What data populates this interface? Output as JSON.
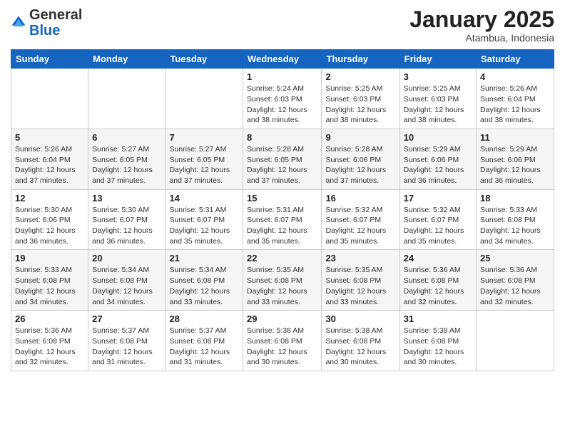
{
  "logo": {
    "general": "General",
    "blue": "Blue"
  },
  "header": {
    "month": "January 2025",
    "location": "Atambua, Indonesia"
  },
  "days_of_week": [
    "Sunday",
    "Monday",
    "Tuesday",
    "Wednesday",
    "Thursday",
    "Friday",
    "Saturday"
  ],
  "weeks": [
    [
      {
        "day": "",
        "info": ""
      },
      {
        "day": "",
        "info": ""
      },
      {
        "day": "",
        "info": ""
      },
      {
        "day": "1",
        "info": "Sunrise: 5:24 AM\nSunset: 6:03 PM\nDaylight: 12 hours and 38 minutes."
      },
      {
        "day": "2",
        "info": "Sunrise: 5:25 AM\nSunset: 6:03 PM\nDaylight: 12 hours and 38 minutes."
      },
      {
        "day": "3",
        "info": "Sunrise: 5:25 AM\nSunset: 6:03 PM\nDaylight: 12 hours and 38 minutes."
      },
      {
        "day": "4",
        "info": "Sunrise: 5:26 AM\nSunset: 6:04 PM\nDaylight: 12 hours and 38 minutes."
      }
    ],
    [
      {
        "day": "5",
        "info": "Sunrise: 5:26 AM\nSunset: 6:04 PM\nDaylight: 12 hours and 37 minutes."
      },
      {
        "day": "6",
        "info": "Sunrise: 5:27 AM\nSunset: 6:05 PM\nDaylight: 12 hours and 37 minutes."
      },
      {
        "day": "7",
        "info": "Sunrise: 5:27 AM\nSunset: 6:05 PM\nDaylight: 12 hours and 37 minutes."
      },
      {
        "day": "8",
        "info": "Sunrise: 5:28 AM\nSunset: 6:05 PM\nDaylight: 12 hours and 37 minutes."
      },
      {
        "day": "9",
        "info": "Sunrise: 5:28 AM\nSunset: 6:06 PM\nDaylight: 12 hours and 37 minutes."
      },
      {
        "day": "10",
        "info": "Sunrise: 5:29 AM\nSunset: 6:06 PM\nDaylight: 12 hours and 36 minutes."
      },
      {
        "day": "11",
        "info": "Sunrise: 5:29 AM\nSunset: 6:06 PM\nDaylight: 12 hours and 36 minutes."
      }
    ],
    [
      {
        "day": "12",
        "info": "Sunrise: 5:30 AM\nSunset: 6:06 PM\nDaylight: 12 hours and 36 minutes."
      },
      {
        "day": "13",
        "info": "Sunrise: 5:30 AM\nSunset: 6:07 PM\nDaylight: 12 hours and 36 minutes."
      },
      {
        "day": "14",
        "info": "Sunrise: 5:31 AM\nSunset: 6:07 PM\nDaylight: 12 hours and 35 minutes."
      },
      {
        "day": "15",
        "info": "Sunrise: 5:31 AM\nSunset: 6:07 PM\nDaylight: 12 hours and 35 minutes."
      },
      {
        "day": "16",
        "info": "Sunrise: 5:32 AM\nSunset: 6:07 PM\nDaylight: 12 hours and 35 minutes."
      },
      {
        "day": "17",
        "info": "Sunrise: 5:32 AM\nSunset: 6:07 PM\nDaylight: 12 hours and 35 minutes."
      },
      {
        "day": "18",
        "info": "Sunrise: 5:33 AM\nSunset: 6:08 PM\nDaylight: 12 hours and 34 minutes."
      }
    ],
    [
      {
        "day": "19",
        "info": "Sunrise: 5:33 AM\nSunset: 6:08 PM\nDaylight: 12 hours and 34 minutes."
      },
      {
        "day": "20",
        "info": "Sunrise: 5:34 AM\nSunset: 6:08 PM\nDaylight: 12 hours and 34 minutes."
      },
      {
        "day": "21",
        "info": "Sunrise: 5:34 AM\nSunset: 6:08 PM\nDaylight: 12 hours and 33 minutes."
      },
      {
        "day": "22",
        "info": "Sunrise: 5:35 AM\nSunset: 6:08 PM\nDaylight: 12 hours and 33 minutes."
      },
      {
        "day": "23",
        "info": "Sunrise: 5:35 AM\nSunset: 6:08 PM\nDaylight: 12 hours and 33 minutes."
      },
      {
        "day": "24",
        "info": "Sunrise: 5:36 AM\nSunset: 6:08 PM\nDaylight: 12 hours and 32 minutes."
      },
      {
        "day": "25",
        "info": "Sunrise: 5:36 AM\nSunset: 6:08 PM\nDaylight: 12 hours and 32 minutes."
      }
    ],
    [
      {
        "day": "26",
        "info": "Sunrise: 5:36 AM\nSunset: 6:08 PM\nDaylight: 12 hours and 32 minutes."
      },
      {
        "day": "27",
        "info": "Sunrise: 5:37 AM\nSunset: 6:08 PM\nDaylight: 12 hours and 31 minutes."
      },
      {
        "day": "28",
        "info": "Sunrise: 5:37 AM\nSunset: 6:08 PM\nDaylight: 12 hours and 31 minutes."
      },
      {
        "day": "29",
        "info": "Sunrise: 5:38 AM\nSunset: 6:08 PM\nDaylight: 12 hours and 30 minutes."
      },
      {
        "day": "30",
        "info": "Sunrise: 5:38 AM\nSunset: 6:08 PM\nDaylight: 12 hours and 30 minutes."
      },
      {
        "day": "31",
        "info": "Sunrise: 5:38 AM\nSunset: 6:08 PM\nDaylight: 12 hours and 30 minutes."
      },
      {
        "day": "",
        "info": ""
      }
    ]
  ]
}
